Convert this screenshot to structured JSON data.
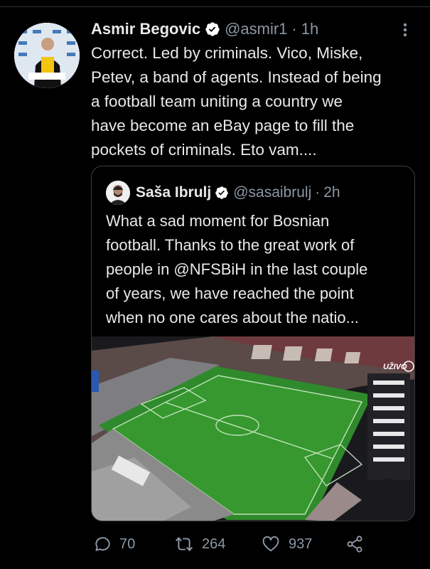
{
  "tweet": {
    "author_name": "Asmir Begovic",
    "handle": "@asmir1",
    "separator": "·",
    "time": "1h",
    "text": "Correct. Led by criminals. Vico, Miske,\nPetev, a band of agents. Instead of being\na football team uniting a country we\nhave become an eBay page to fill the\npockets of criminals. Eto vam....",
    "icons": {
      "verified": "verified-badge-icon",
      "more": "more-vertical-icon"
    }
  },
  "quoted_tweet": {
    "author_name": "Saša Ibrulj",
    "handle": "@sasaibrulj",
    "separator": "·",
    "time": "2h",
    "text": "What a sad moment for Bosnian\nfootball. Thanks to the great work of\npeople in @NFSBiH in the last couple\nof years, we have reached the point\nwhen no one cares about the natio...",
    "media_overlay_text": "UŽIVO"
  },
  "actions": {
    "replies": "70",
    "retweets": "264",
    "likes": "937",
    "icons": [
      "reply-icon",
      "retweet-icon",
      "like-icon",
      "share-icon"
    ]
  },
  "colors": {
    "background": "#000000",
    "text": "#e7e9ea",
    "muted": "#8b98a5",
    "verified": "#ffffff",
    "border": "#3a3d40"
  }
}
